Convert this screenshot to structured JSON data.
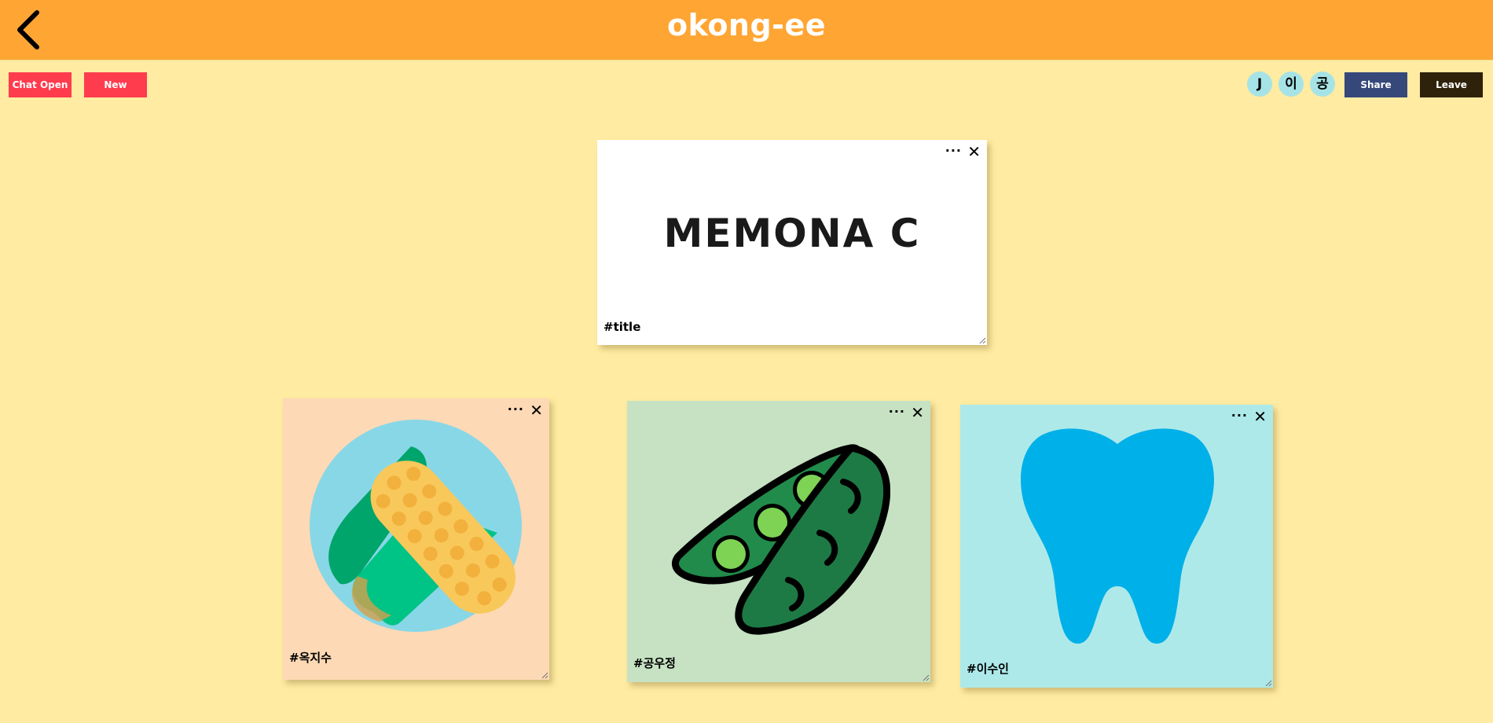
{
  "header": {
    "app_title": "okong-ee",
    "back_icon": "chevron-left-icon",
    "background": "#ffa533"
  },
  "toolbar": {
    "chat_open_label": "Chat Open",
    "new_label": "New",
    "share_label": "Share",
    "leave_label": "Leave",
    "colors": {
      "chat": "#ff3b4e",
      "new": "#ff3b4e",
      "share": "#36487a",
      "leave": "#2e220b"
    }
  },
  "participants": [
    {
      "initial": "J"
    },
    {
      "initial": "이"
    },
    {
      "initial": "공"
    }
  ],
  "memos": [
    {
      "content": "MEMONA C",
      "tag": "#title",
      "color": "#ffffff"
    },
    {
      "image": "corn-icon",
      "tag": "#옥지수",
      "color": "#fdd9b5"
    },
    {
      "image": "peapod-icon",
      "tag": "#공우정",
      "color": "#c6e2c3"
    },
    {
      "image": "tooth-icon",
      "tag": "#이수인",
      "color": "#aee9ea"
    }
  ],
  "memo_menu_icon": "more-icon",
  "memo_close_icon": "close-icon"
}
